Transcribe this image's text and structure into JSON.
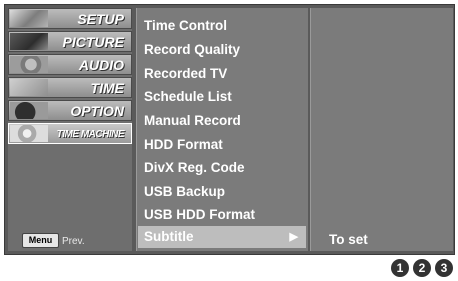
{
  "categories": [
    {
      "label": "SETUP",
      "icon": "setup-thumbnail-icon"
    },
    {
      "label": "PICTURE",
      "icon": "picture-thumbnail-icon"
    },
    {
      "label": "AUDIO",
      "icon": "audio-thumbnail-icon"
    },
    {
      "label": "TIME",
      "icon": "time-thumbnail-icon"
    },
    {
      "label": "OPTION",
      "icon": "option-thumbnail-icon"
    },
    {
      "label": "TIME MACHINE",
      "icon": "time-machine-thumbnail-icon"
    }
  ],
  "footer": {
    "menu_button": "Menu",
    "prev_label": "Prev."
  },
  "submenu": {
    "items": [
      "Time Control",
      "Record Quality",
      "Recorded TV",
      "Schedule List",
      "Manual Record",
      "HDD Format",
      "DivX Reg. Code",
      "USB Backup",
      "USB HDD Format",
      "Subtitle"
    ],
    "selected_index": 9,
    "arrow": "▶"
  },
  "value_pane": {
    "text": "To set"
  },
  "steps": [
    "1",
    "2",
    "3"
  ],
  "colors": {
    "panel": "#7b7b7b",
    "highlight": "#bdbdbd",
    "badge": "#333333"
  }
}
